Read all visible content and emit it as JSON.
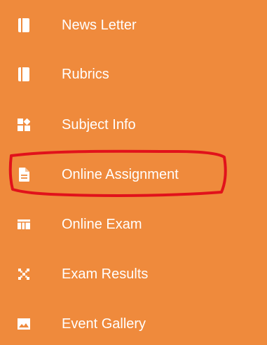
{
  "sidebar": {
    "items": [
      {
        "label": "News Letter",
        "icon": "book-icon"
      },
      {
        "label": "Rubrics",
        "icon": "book-icon"
      },
      {
        "label": "Subject Info",
        "icon": "puzzle-icon"
      },
      {
        "label": "Online Assignment",
        "icon": "document-icon"
      },
      {
        "label": "Online Exam",
        "icon": "board-icon"
      },
      {
        "label": "Exam Results",
        "icon": "pattern-icon"
      },
      {
        "label": "Event Gallery",
        "icon": "image-icon"
      }
    ]
  },
  "colors": {
    "background": "#ef8a3c",
    "text": "#ffffff",
    "annotation": "#e1121b"
  }
}
